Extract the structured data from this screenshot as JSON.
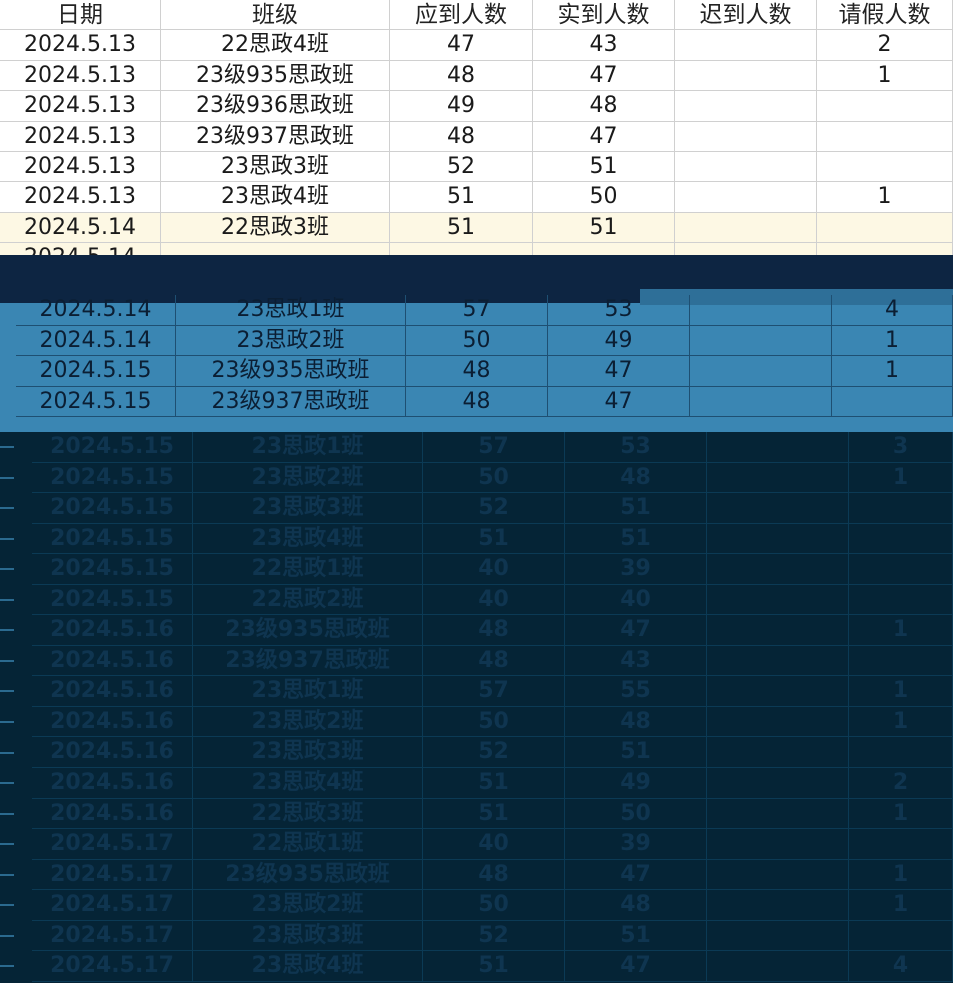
{
  "headers": [
    "日期",
    "班级",
    "应到人数",
    "实到人数",
    "迟到人数",
    "请假人数"
  ],
  "section1_rows": [
    [
      "2024.5.13",
      "22思政4班",
      "47",
      "43",
      "",
      "2"
    ],
    [
      "2024.5.13",
      "23级935思政班",
      "48",
      "47",
      "",
      "1"
    ],
    [
      "2024.5.13",
      "23级936思政班",
      "49",
      "48",
      "",
      ""
    ],
    [
      "2024.5.13",
      "23级937思政班",
      "48",
      "47",
      "",
      ""
    ],
    [
      "2024.5.13",
      "23思政3班",
      "52",
      "51",
      "",
      ""
    ],
    [
      "2024.5.13",
      "23思政4班",
      "51",
      "50",
      "",
      "1"
    ],
    [
      "2024.5.14",
      "22思政3班",
      "51",
      "51",
      "",
      ""
    ],
    [
      "2024.5.14",
      "",
      "",
      "",
      "",
      ""
    ]
  ],
  "section2_rows": [
    [
      "2024.5.14",
      "23思政1班",
      "57",
      "53",
      "",
      "4"
    ],
    [
      "2024.5.14",
      "23思政2班",
      "50",
      "49",
      "",
      "1"
    ],
    [
      "2024.5.15",
      "23级935思政班",
      "48",
      "47",
      "",
      "1"
    ],
    [
      "2024.5.15",
      "23级937思政班",
      "48",
      "47",
      "",
      ""
    ]
  ],
  "section3_rows": [
    [
      "2024.5.15",
      "23思政1班",
      "57",
      "53",
      "",
      "3"
    ],
    [
      "2024.5.15",
      "23思政2班",
      "50",
      "48",
      "",
      "1"
    ],
    [
      "2024.5.15",
      "23思政3班",
      "52",
      "51",
      "",
      ""
    ],
    [
      "2024.5.15",
      "23思政4班",
      "51",
      "51",
      "",
      ""
    ],
    [
      "2024.5.15",
      "22思政1班",
      "40",
      "39",
      "",
      ""
    ],
    [
      "2024.5.15",
      "22思政2班",
      "40",
      "40",
      "",
      ""
    ],
    [
      "2024.5.16",
      "23级935思政班",
      "48",
      "47",
      "",
      "1"
    ],
    [
      "2024.5.16",
      "23级937思政班",
      "48",
      "43",
      "",
      ""
    ],
    [
      "2024.5.16",
      "23思政1班",
      "57",
      "55",
      "",
      "1"
    ],
    [
      "2024.5.16",
      "23思政2班",
      "50",
      "48",
      "",
      "1"
    ],
    [
      "2024.5.16",
      "23思政3班",
      "52",
      "51",
      "",
      ""
    ],
    [
      "2024.5.16",
      "23思政4班",
      "51",
      "49",
      "",
      "2"
    ],
    [
      "2024.5.16",
      "22思政3班",
      "51",
      "50",
      "",
      "1"
    ],
    [
      "2024.5.17",
      "22思政1班",
      "40",
      "39",
      "",
      ""
    ],
    [
      "2024.5.17",
      "23级935思政班",
      "48",
      "47",
      "",
      "1"
    ],
    [
      "2024.5.17",
      "23思政2班",
      "50",
      "48",
      "",
      "1"
    ],
    [
      "2024.5.17",
      "23思政3班",
      "52",
      "51",
      "",
      ""
    ],
    [
      "2024.5.17",
      "23思政4班",
      "51",
      "47",
      "",
      "4"
    ]
  ],
  "colors": {
    "section1_bg": "#ffffff",
    "highlight_row": "#fdf8e4",
    "band_dark": "#0d2542",
    "section2_bg": "#3a86b3",
    "section3_bg": "#052436"
  }
}
